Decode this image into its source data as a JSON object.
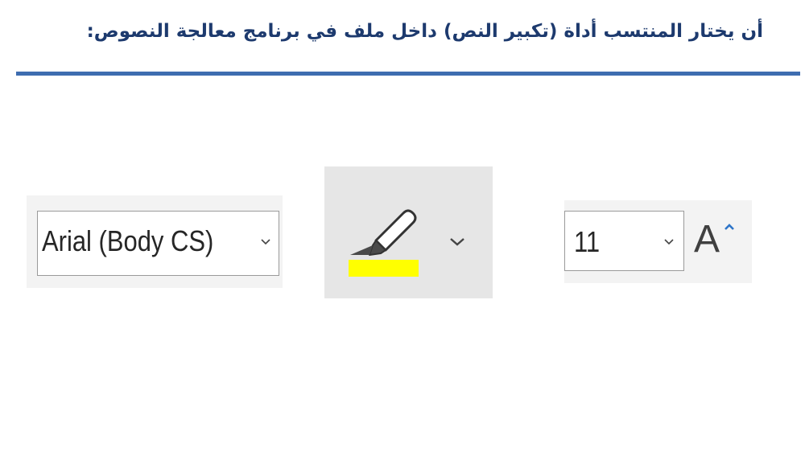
{
  "header": {
    "question": "أن يختار المنتسب أداة (تكبير النص) داخل ملف في برنامج معالجة النصوص:"
  },
  "font_name": {
    "value": "Arial (Body CS)",
    "dropdown_icon": "chevron-down-icon"
  },
  "highlighter": {
    "icon": "highlighter-pen-icon",
    "color": "#ffff00",
    "dropdown_icon": "chevron-down-icon"
  },
  "font_size": {
    "value": "11",
    "dropdown_icon": "chevron-down-icon"
  },
  "grow_font": {
    "glyph": "A",
    "icon": "caret-up-icon",
    "caret_color": "#2e75c8"
  },
  "colors": {
    "heading": "#1d3a6e",
    "rule": "#3e6db0"
  }
}
